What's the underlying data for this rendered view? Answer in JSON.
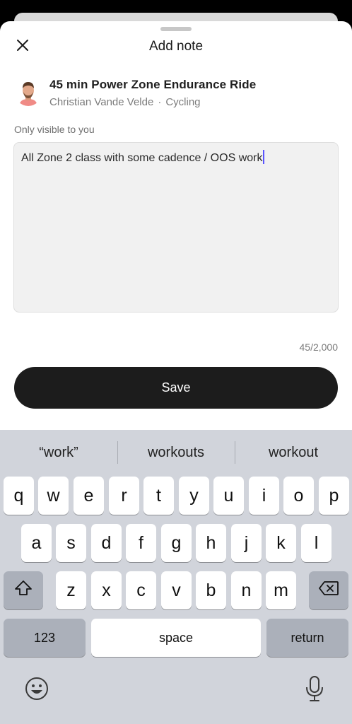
{
  "sheet": {
    "title": "Add note",
    "close_icon": "close-icon"
  },
  "class_info": {
    "title": "45 min Power Zone Endurance Ride",
    "instructor": "Christian Vande Velde",
    "separator": "·",
    "category": "Cycling"
  },
  "note": {
    "visibility_label": "Only visible to you",
    "text": "All Zone 2 class with some cadence / OOS work",
    "counter": "45/2,000"
  },
  "save_button": {
    "label": "Save"
  },
  "keyboard": {
    "suggestions": [
      "“work”",
      "workouts",
      "workout"
    ],
    "row1": [
      "q",
      "w",
      "e",
      "r",
      "t",
      "y",
      "u",
      "i",
      "o",
      "p"
    ],
    "row2": [
      "a",
      "s",
      "d",
      "f",
      "g",
      "h",
      "j",
      "k",
      "l"
    ],
    "row3": [
      "z",
      "x",
      "c",
      "v",
      "b",
      "n",
      "m"
    ],
    "numbers_label": "123",
    "space_label": "space",
    "return_label": "return",
    "icons": [
      "shift-icon",
      "backspace-icon",
      "emoji-icon",
      "microphone-icon"
    ]
  },
  "colors": {
    "accent_caret": "#5a55ff",
    "save_button_bg": "#1c1c1c",
    "keyboard_bg": "#d1d4db"
  }
}
